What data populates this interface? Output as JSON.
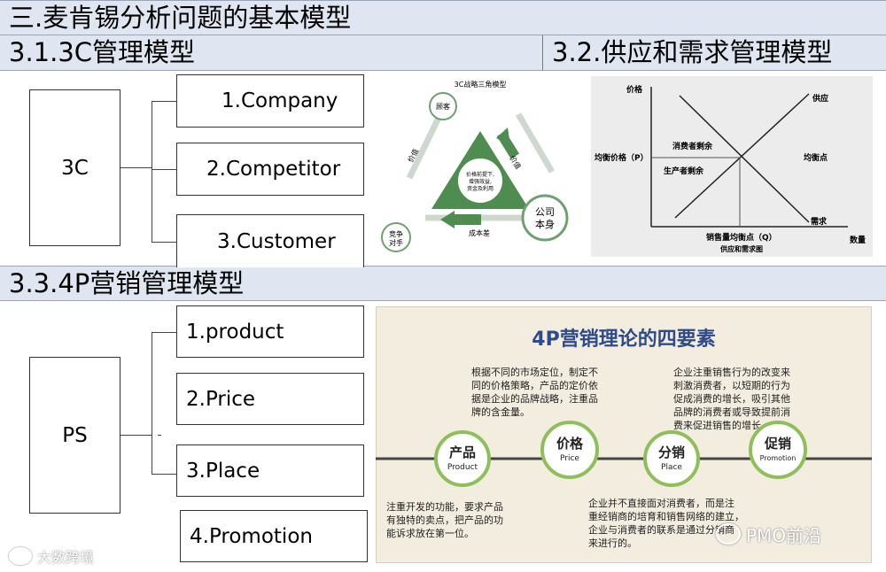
{
  "header": {
    "title": "三.麦肯锡分析问题的基本模型"
  },
  "section_3c": {
    "title": "3.1.3C管理模型",
    "root": "3C",
    "items": [
      "1.Company",
      "2.Competitor",
      "3.Customer"
    ]
  },
  "section_supply": {
    "title": "3.2.供应和需求管理模型"
  },
  "section_4p": {
    "title": "3.3.4P营销管理模型",
    "root": "PS",
    "items": [
      "1.product",
      "2.Price",
      "3.Place",
      "4.Promotion"
    ]
  },
  "triangle_image": {
    "title": "3C战略三角模型",
    "customer": "顾客",
    "company_1": "公司",
    "company_2": "本身",
    "competitor_1": "竞争",
    "competitor_2": "对手",
    "value_left": "价值",
    "value_right": "价值",
    "cost_diff": "成本差",
    "center_1": "价格前提下,",
    "center_2": "增强效益,",
    "center_3": "资金及利用"
  },
  "supply_chart": {
    "y_label": "价格",
    "x_label": "数量",
    "supply": "供应",
    "demand": "需求",
    "equilibrium": "均衡点",
    "equilibrium_price": "均衡价格（P）",
    "consumer_surplus": "消费者剩余",
    "producer_surplus": "生产者剩余",
    "equilibrium_qty": "销售量均衡点（Q）",
    "caption": "供应和需求图"
  },
  "p4_image": {
    "title": "4P营销理论的四要素",
    "price_text": [
      "根据不同的市场定位，制定不",
      "同的价格策略，产品的定价依",
      "据是企业的品牌战略，注重品",
      "牌的含金量。"
    ],
    "promotion_text": [
      "企业注重销售行为的改变来",
      "刺激消费者，以短期的行为",
      "促成消费的增长，吸引其他",
      "品牌的消费者或导致提前消",
      "费来促进销售的增长。"
    ],
    "product_text": [
      "注重开发的功能，要求产品",
      "有独特的卖点，把产品的功",
      "能诉求放在第一位。"
    ],
    "place_text": [
      "企业并不直接面对消费者，而是注",
      "重经销商的培育和销售网络的建立，",
      "企业与消费者的联系是通过分销商",
      "来进行的。"
    ],
    "nodes": [
      {
        "cn": "产品",
        "en": "Product"
      },
      {
        "cn": "价格",
        "en": "Price"
      },
      {
        "cn": "分销",
        "en": "Place"
      },
      {
        "cn": "促销",
        "en": "Promotion"
      }
    ]
  },
  "watermarks": {
    "left": "大数跨境",
    "right": "PMO前沿"
  }
}
